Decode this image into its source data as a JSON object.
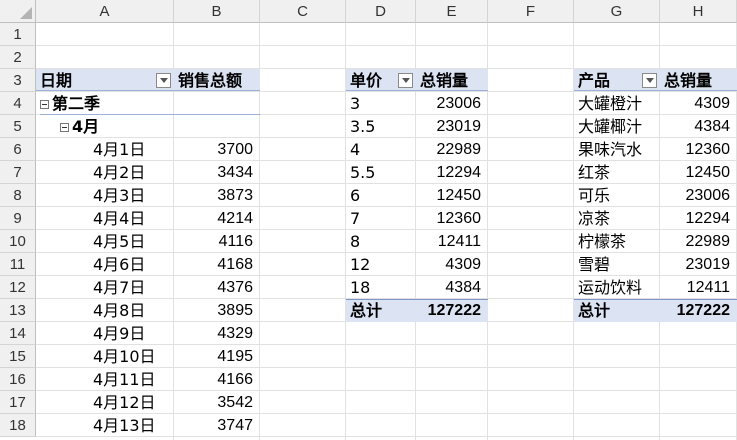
{
  "columns": [
    "A",
    "B",
    "C",
    "D",
    "E",
    "F",
    "G",
    "H"
  ],
  "rows": [
    "1",
    "2",
    "3",
    "4",
    "5",
    "6",
    "7",
    "8",
    "9",
    "10",
    "11",
    "12",
    "13",
    "14",
    "15",
    "16",
    "17",
    "18"
  ],
  "pivot1": {
    "h_label": "日期",
    "h_value": "销售总额",
    "group": "第二季",
    "subgroup": "4月",
    "items": [
      {
        "label": "4月1日",
        "value": "3700"
      },
      {
        "label": "4月2日",
        "value": "3434"
      },
      {
        "label": "4月3日",
        "value": "3873"
      },
      {
        "label": "4月4日",
        "value": "4214"
      },
      {
        "label": "4月5日",
        "value": "4116"
      },
      {
        "label": "4月6日",
        "value": "4168"
      },
      {
        "label": "4月7日",
        "value": "4376"
      },
      {
        "label": "4月8日",
        "value": "3895"
      },
      {
        "label": "4月9日",
        "value": "4329"
      },
      {
        "label": "4月10日",
        "value": "4195"
      },
      {
        "label": "4月11日",
        "value": "4166"
      },
      {
        "label": "4月12日",
        "value": "3542"
      },
      {
        "label": "4月13日",
        "value": "3747"
      }
    ]
  },
  "pivot2": {
    "h_label": "单价",
    "h_value": "总销量",
    "items": [
      {
        "label": "3",
        "value": "23006"
      },
      {
        "label": "3.5",
        "value": "23019"
      },
      {
        "label": "4",
        "value": "22989"
      },
      {
        "label": "5.5",
        "value": "12294"
      },
      {
        "label": "6",
        "value": "12450"
      },
      {
        "label": "7",
        "value": "12360"
      },
      {
        "label": "8",
        "value": "12411"
      },
      {
        "label": "12",
        "value": "4309"
      },
      {
        "label": "18",
        "value": "4384"
      }
    ],
    "total_label": "总计",
    "total_value": "127222"
  },
  "pivot3": {
    "h_label": "产品",
    "h_value": "总销量",
    "items": [
      {
        "label": "大罐橙汁",
        "value": "4309"
      },
      {
        "label": "大罐椰汁",
        "value": "4384"
      },
      {
        "label": "果味汽水",
        "value": "12360"
      },
      {
        "label": "红茶",
        "value": "12450"
      },
      {
        "label": "可乐",
        "value": "23006"
      },
      {
        "label": "凉茶",
        "value": "12294"
      },
      {
        "label": "柠檬茶",
        "value": "22989"
      },
      {
        "label": "雪碧",
        "value": "23019"
      },
      {
        "label": "运动饮料",
        "value": "12411"
      }
    ],
    "total_label": "总计",
    "total_value": "127222"
  }
}
